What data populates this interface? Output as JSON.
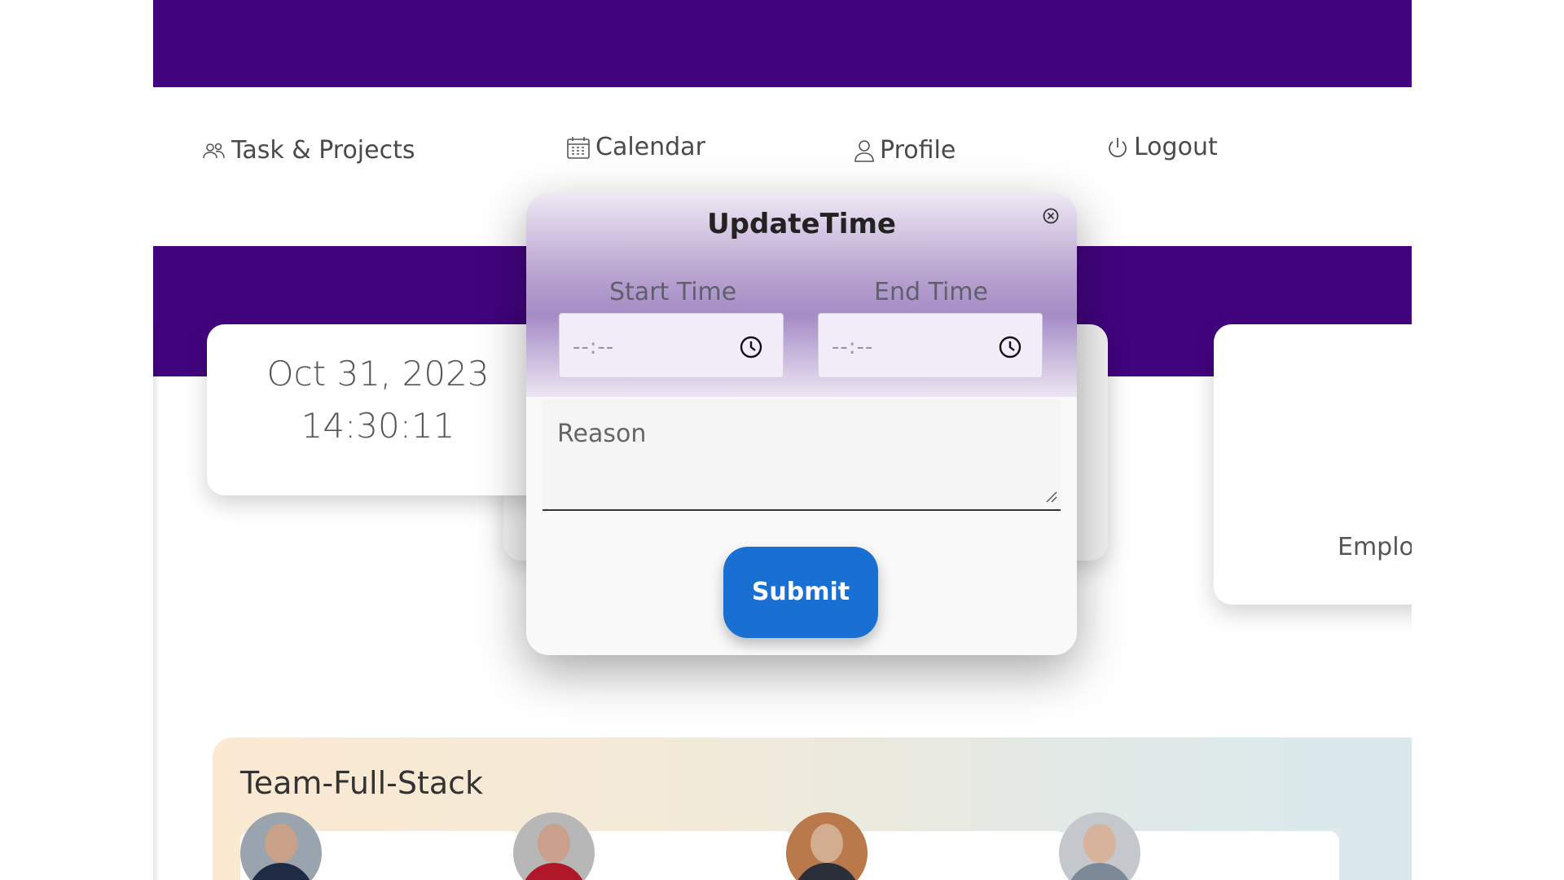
{
  "nav": {
    "items": [
      {
        "label": "Task & Projects",
        "icon": "users-icon"
      },
      {
        "label": "Calendar",
        "icon": "calendar-icon"
      },
      {
        "label": "Profile",
        "icon": "user-icon"
      },
      {
        "label": "Logout",
        "icon": "power-icon"
      }
    ]
  },
  "dashboard": {
    "date": "Oct 31, 2023",
    "time": "14:30:11",
    "right_card_label": "Emplo"
  },
  "team": {
    "title": "Team-Full-Stack",
    "members_count_visible": 4
  },
  "modal": {
    "title": "UpdateTime",
    "start_label": "Start Time",
    "end_label": "End Time",
    "start_placeholder": "--:--",
    "end_placeholder": "--:--",
    "reason_placeholder": "Reason",
    "submit_label": "Submit"
  },
  "colors": {
    "brand_purple": "#42047e",
    "submit_blue": "#1a6fd3"
  }
}
